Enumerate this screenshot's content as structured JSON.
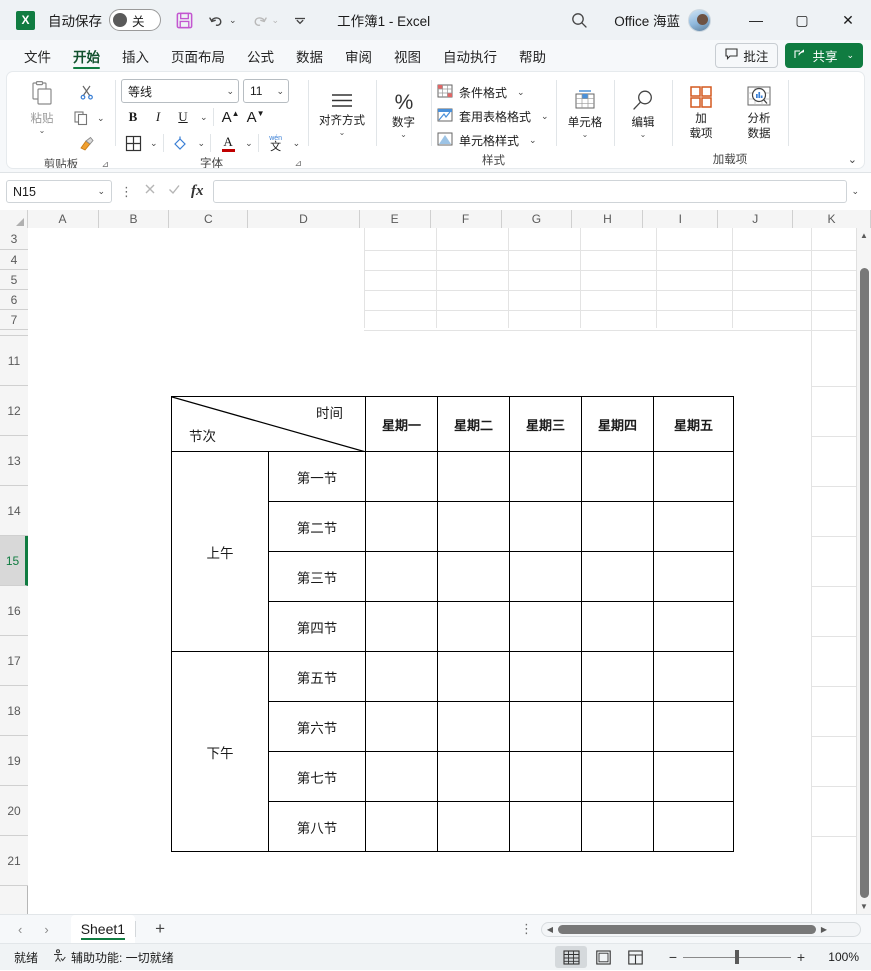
{
  "titlebar": {
    "app_logo": "excel-logo",
    "autosave_label": "自动保存",
    "autosave_state": "关",
    "save_icon": "save-icon",
    "undo_icon": "undo-icon",
    "redo_icon": "redo-icon",
    "customize_icon": "customize-quick-access-icon",
    "document_title": "工作簿1  -  Excel",
    "search_icon": "search-icon",
    "account_name": "Office 海蓝",
    "minimize": "—",
    "maximize": "▢",
    "close": "✕"
  },
  "ribbon_tabs": [
    {
      "label": "文件",
      "active": false
    },
    {
      "label": "开始",
      "active": true
    },
    {
      "label": "插入",
      "active": false
    },
    {
      "label": "页面布局",
      "active": false
    },
    {
      "label": "公式",
      "active": false
    },
    {
      "label": "数据",
      "active": false
    },
    {
      "label": "审阅",
      "active": false
    },
    {
      "label": "视图",
      "active": false
    },
    {
      "label": "自动执行",
      "active": false
    },
    {
      "label": "帮助",
      "active": false
    }
  ],
  "tabbar_actions": {
    "comment_label": "批注",
    "share_label": "共享"
  },
  "ribbon": {
    "clipboard": {
      "group_label": "剪贴板",
      "paste_label": "粘贴",
      "cut_icon": "scissors-icon",
      "copy_icon": "copy-icon",
      "format_painter_icon": "format-painter-icon"
    },
    "font": {
      "group_label": "字体",
      "font_name": "等线",
      "font_size": "11",
      "bold": "B",
      "italic": "I",
      "underline": "U",
      "grow_font": "A",
      "shrink_font": "A",
      "borders_icon": "borders-icon",
      "fill_color_icon": "fill-color-icon",
      "font_color": "A",
      "phonetic_guide": "文"
    },
    "alignment": {
      "group_label": "对齐方式"
    },
    "number": {
      "group_label": "数字",
      "icon": "percent-icon"
    },
    "styles": {
      "group_label": "样式",
      "items": [
        "条件格式",
        "套用表格格式",
        "单元格样式"
      ]
    },
    "cells": {
      "group_label": "单元格"
    },
    "editing": {
      "group_label": "编辑"
    },
    "addins": {
      "group_label": "加载项",
      "addin_label": "加\n载项",
      "addin_line1": "加",
      "addin_line2": "载项",
      "analyze_line1": "分析",
      "analyze_line2": "数据"
    }
  },
  "formula_bar": {
    "name_box": "N15",
    "cancel_icon": "cancel-icon",
    "enter_icon": "confirm-icon",
    "function_icon": "fx",
    "formula_value": ""
  },
  "grid": {
    "columns": [
      "A",
      "B",
      "C",
      "D",
      "E",
      "F",
      "G",
      "H",
      "I",
      "J",
      "K"
    ],
    "rows": [
      "3",
      "4",
      "5",
      "6",
      "7",
      "11",
      "12",
      "13",
      "14",
      "15",
      "16",
      "17",
      "18",
      "19",
      "20",
      "21"
    ],
    "selected_row": "15",
    "selected_cell": "N15"
  },
  "schedule": {
    "corner_top_label": "时间",
    "corner_bottom_label": "节次",
    "weekdays": [
      "星期一",
      "星期二",
      "星期三",
      "星期四",
      "星期五"
    ],
    "sections": [
      {
        "name": "上午",
        "periods": [
          "第一节",
          "第二节",
          "第三节",
          "第四节"
        ]
      },
      {
        "name": "下午",
        "periods": [
          "第五节",
          "第六节",
          "第七节",
          "第八节"
        ]
      }
    ]
  },
  "sheetbar": {
    "prev_icon": "chevron-left-icon",
    "next_icon": "chevron-right-icon",
    "tabs": [
      "Sheet1"
    ],
    "active_tab": "Sheet1",
    "add_sheet": "+"
  },
  "statusbar": {
    "ready_text": "就绪",
    "accessibility_text": "辅助功能: 一切就绪",
    "views": [
      "normal-view",
      "page-layout-view",
      "page-break-view"
    ],
    "active_view": "normal-view",
    "zoom_out": "−",
    "zoom_in": "+",
    "zoom_level": "100%"
  },
  "colors": {
    "accent": "#107c41",
    "titlebar_bg": "#eef2f5",
    "ribbon_bg": "#f6f8fa"
  }
}
